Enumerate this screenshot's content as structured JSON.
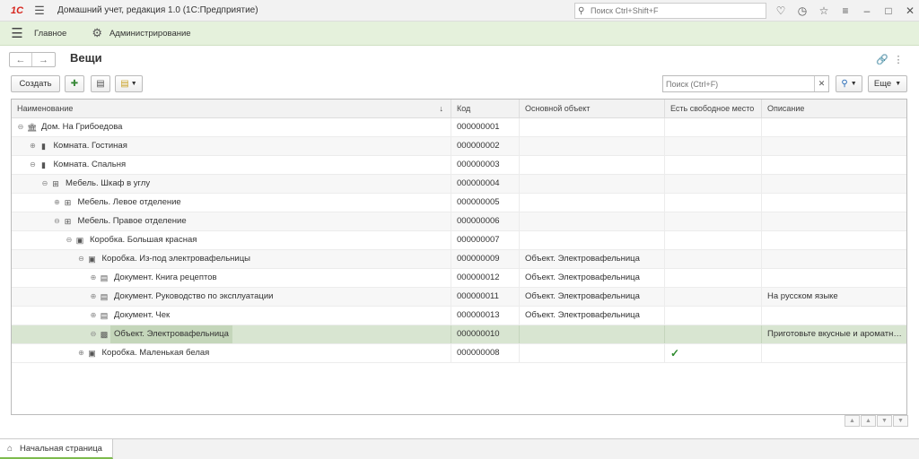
{
  "titlebar": {
    "logo": "1С",
    "app_title": "Домашний учет, редакция 1.0  (1С:Предприятие)",
    "search_placeholder": "Поиск Ctrl+Shift+F"
  },
  "sections": {
    "main_label": "Главное",
    "admin_label": "Администрирование"
  },
  "page": {
    "title": "Вещи"
  },
  "toolbar": {
    "create_label": "Создать",
    "search_placeholder": "Поиск (Ctrl+F)",
    "more_label": "Еще"
  },
  "table": {
    "columns": [
      "Наименование",
      "Код",
      "Основной объект",
      "Есть свободное место",
      "Описание"
    ],
    "rows": [
      {
        "name": "Дом. На Грибоедова",
        "code": "000000001",
        "object": "",
        "free": "",
        "desc": "",
        "icon": "house-icon",
        "toggle": "collapse-icon",
        "level": 0
      },
      {
        "name": "Комната. Гостиная",
        "code": "000000002",
        "object": "",
        "free": "",
        "desc": "",
        "icon": "room-icon",
        "toggle": "expand-icon",
        "level": 1
      },
      {
        "name": "Комната. Спальня",
        "code": "000000003",
        "object": "",
        "free": "",
        "desc": "",
        "icon": "room-icon",
        "toggle": "collapse-icon",
        "level": 1
      },
      {
        "name": "Мебель. Шкаф в углу",
        "code": "000000004",
        "object": "",
        "free": "",
        "desc": "",
        "icon": "furniture-icon",
        "toggle": "collapse-icon",
        "level": 2
      },
      {
        "name": "Мебель. Левое отделение",
        "code": "000000005",
        "object": "",
        "free": "",
        "desc": "",
        "icon": "furniture-icon",
        "toggle": "expand-icon",
        "level": 3
      },
      {
        "name": "Мебель. Правое отделение",
        "code": "000000006",
        "object": "",
        "free": "",
        "desc": "",
        "icon": "furniture-icon",
        "toggle": "collapse-icon",
        "level": 3
      },
      {
        "name": "Коробка. Большая красная",
        "code": "000000007",
        "object": "",
        "free": "",
        "desc": "",
        "icon": "box-icon",
        "toggle": "collapse-icon",
        "level": 4
      },
      {
        "name": "Коробка. Из-под электровафельницы",
        "code": "000000009",
        "object": "Объект. Электровафельница",
        "free": "",
        "desc": "",
        "icon": "box-icon",
        "toggle": "collapse-icon",
        "level": 5
      },
      {
        "name": "Документ. Книга рецептов",
        "code": "000000012",
        "object": "Объект. Электровафельница",
        "free": "",
        "desc": "",
        "icon": "document-icon",
        "toggle": "expand-icon",
        "level": 6
      },
      {
        "name": "Документ. Руководство по эксплуатации",
        "code": "000000011",
        "object": "Объект. Электровафельница",
        "free": "",
        "desc": "На русском языке",
        "icon": "document-icon",
        "toggle": "expand-icon",
        "level": 6
      },
      {
        "name": "Документ. Чек",
        "code": "000000013",
        "object": "Объект. Электровафельница",
        "free": "",
        "desc": "",
        "icon": "document-icon",
        "toggle": "expand-icon",
        "level": 6
      },
      {
        "name": "Объект. Электровафельница",
        "code": "000000010",
        "object": "",
        "free": "",
        "desc": "Приготовьте вкусные и ароматные вафли",
        "icon": "object-icon",
        "toggle": "collapse-icon",
        "level": 6,
        "selected": true
      },
      {
        "name": "Коробка. Маленькая белая",
        "code": "000000008",
        "object": "",
        "free": "✓",
        "desc": "",
        "icon": "box-icon",
        "toggle": "expand-icon",
        "level": 5
      }
    ]
  },
  "bottom": {
    "home_tab_label": "Начальная страница"
  }
}
